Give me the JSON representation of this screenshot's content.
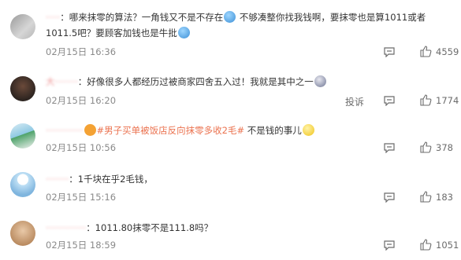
{
  "comments": [
    {
      "username": "·····",
      "text_a": "：哪来抹零的算法？一角钱又不是不存在",
      "text_b": " 不够凑整你找我钱啊，要抹零也是算1011或者1011.5吧？要顾客加钱也是牛批",
      "time": "02月15日 16:36",
      "likes": "4559",
      "emoji": [
        "sweat-emoji",
        "sweat-emoji"
      ]
    },
    {
      "username": "大········",
      "text_a": "：好像很多人都经历过被商家四舍五入过！我就是其中之一",
      "time": "02月15日 16:20",
      "report": "投诉",
      "likes": "1774",
      "emoji": [
        "crying-emoji"
      ]
    },
    {
      "username": "·············",
      "topic": "#男子买单被饭店反向抹零多收2毛#",
      "text_a": " 不是钱的事儿",
      "time": "02月15日 10:56",
      "likes": "378",
      "emoji": [
        "glasses-emoji"
      ]
    },
    {
      "username": "········",
      "text_a": "：1千块在乎2毛钱，",
      "time": "02月15日 15:16",
      "likes": "183"
    },
    {
      "username": "··············",
      "text_a": "：1011.80抹零不是111.8吗？",
      "time": "02月15日 18:59",
      "likes": "1051"
    }
  ],
  "colors": {
    "username": "#e03c3c",
    "topic": "#eb7350",
    "meta": "#8a8a8a"
  }
}
